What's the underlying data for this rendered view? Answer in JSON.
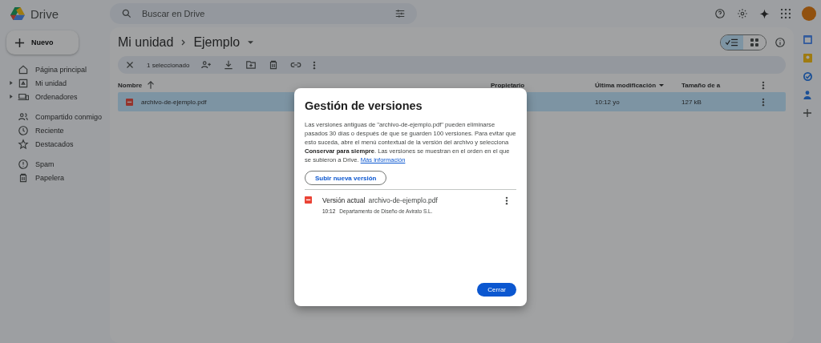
{
  "app": {
    "title": "Drive"
  },
  "search": {
    "placeholder": "Buscar en Drive"
  },
  "new_button": "Nuevo",
  "sidebar": {
    "groups": [
      [
        {
          "label": "Página principal",
          "expandable": false
        },
        {
          "label": "Mi unidad",
          "expandable": true
        },
        {
          "label": "Ordenadores",
          "expandable": true
        }
      ],
      [
        {
          "label": "Compartido conmigo",
          "expandable": false
        },
        {
          "label": "Reciente",
          "expandable": false
        },
        {
          "label": "Destacados",
          "expandable": false
        }
      ],
      [
        {
          "label": "Spam",
          "expandable": false
        },
        {
          "label": "Papelera",
          "expandable": false
        }
      ]
    ]
  },
  "breadcrumb": [
    "Mi unidad",
    "Ejemplo"
  ],
  "view_toggle": [
    {
      "kind": "list",
      "selected": true
    },
    {
      "kind": "grid",
      "selected": false
    }
  ],
  "selection_bar": {
    "count": "1 seleccionado"
  },
  "table": {
    "columns": [
      "Nombre",
      "Propietario",
      "Última modificación",
      "Tamaño de a"
    ],
    "rows": [
      {
        "name": "archivo-de-ejemplo.pdf",
        "modified": "10:12 yo",
        "size": "127 kB",
        "selected": true
      }
    ]
  },
  "dialog": {
    "title": "Gestión de versiones",
    "body": "Las versiones antiguas de \"archivo-de-ejemplo.pdf\" pueden eliminarse pasados 30 días o después de que se guarden 100 versiones. Para evitar que esto suceda, abre el menú contextual de la versión del archivo y selecciona **Conservar para siempre**. Las versiones se muestran en el orden en el que se subieron a Drive.",
    "link": "Más información",
    "upload_button": "Subir nueva versión",
    "versions": [
      {
        "label": "Versión actual",
        "file": "archivo-de-ejemplo.pdf",
        "time": "10:12",
        "author": "Departamento de Diseño de Avirato S.L."
      }
    ],
    "close_button": "Cerrar"
  }
}
